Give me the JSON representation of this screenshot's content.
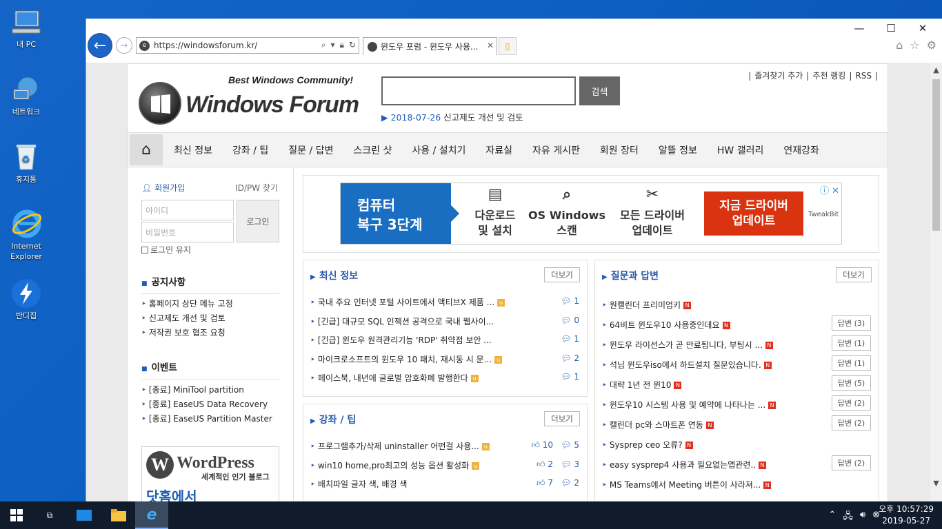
{
  "desktop": {
    "icons": [
      {
        "label": "내 PC"
      },
      {
        "label": "네트워크"
      },
      {
        "label": "휴지통"
      },
      {
        "label": "Internet Explorer"
      },
      {
        "label": "반디집"
      }
    ]
  },
  "browser": {
    "url": "https://windowsforum.kr/",
    "tab_title": "윈도우 포럼 - 윈도우 사용...",
    "window_controls": {
      "minimize": "—",
      "maximize": "☐",
      "close": "✕"
    }
  },
  "site": {
    "tagline": "Best Windows Community!",
    "logo_text": "Windows Forum",
    "search_button": "검색",
    "notice_date": "2018-07-26",
    "notice_text": " 신고제도 개선 및 검토",
    "top_links": [
      "즐겨찾기 추가",
      "추천 랭킹",
      "RSS"
    ],
    "menu": [
      "최신 정보",
      "강좌 / 팁",
      "질문 / 답변",
      "스크린 샷",
      "사용 / 설치기",
      "자료실",
      "자유 게시판",
      "회원 장터",
      "알뜰 정보",
      "HW 갤러리",
      "연재강좌"
    ],
    "login": {
      "join": "회원가입",
      "find": "ID/PW 찾기",
      "id_placeholder": "아이디",
      "pw_placeholder": "비밀번호",
      "login_button": "로그인",
      "keep": "로그인 유지"
    },
    "notices": {
      "title": "공지사항",
      "items": [
        "홈페이지 상단 메뉴 고정",
        "신고제도 개선 및 검토",
        "저작권 보호 협조 요청"
      ]
    },
    "events": {
      "title": "이벤트",
      "items": [
        "[종료] MiniTool partition",
        "[종료] EaseUS Data Recovery",
        "[종료] EaseUS Partition Master"
      ]
    },
    "wp_banner": {
      "logo": "W",
      "name": "WordPress",
      "sub": "세계적인 인기 블로그",
      "big": "닷홈에서"
    },
    "ad": {
      "left_line1": "컴퓨터",
      "left_line2": "복구 3단계",
      "item1_l1": "다운로드",
      "item1_l2": "및 설치",
      "item2_l1": "OS Windows",
      "item2_l2": "스캔",
      "item3_l1": "모든 드라이버",
      "item3_l2": "업데이트",
      "cta_l1": "지금 드라이버",
      "cta_l2": "업데이트",
      "brand": "TweakBit",
      "close": "ⓘ ✕"
    },
    "latest": {
      "title": "최신 정보",
      "more": "더보기",
      "items": [
        {
          "t": "국내 주요 인터넷 포털 사이트에서 액티브X 제품 ...",
          "c": "1",
          "u": true
        },
        {
          "t": "[긴급] 대규모 SQL 인젝션 공격으로 국내 웹사이...",
          "c": "0",
          "u": false
        },
        {
          "t": "[긴급] 윈도우 원격관리기능 'RDP' 취약점 보안 ...",
          "c": "1",
          "u": false
        },
        {
          "t": "마이크로소프트의 윈도우 10 패치, 재시동 시 문...",
          "c": "2",
          "u": true
        },
        {
          "t": "페이스북, 내년에 글로벌 암호화폐 발행한다",
          "c": "1",
          "u": true
        }
      ]
    },
    "tips": {
      "title": "강좌 / 팁",
      "more": "더보기",
      "items": [
        {
          "t": "프로그램추가/삭제 uninstaller 어떤걸 사용...",
          "l": "10",
          "c": "5"
        },
        {
          "t": "win10 home,pro최고의 성능 옵션 활성화",
          "l": "2",
          "c": "3"
        },
        {
          "t": "배치파일 글자 색, 배경 색",
          "l": "7",
          "c": "2"
        }
      ]
    },
    "qa": {
      "title": "질문과 답변",
      "more": "더보기",
      "items": [
        {
          "t": "원캘린더 프리미엄키",
          "a": ""
        },
        {
          "t": "64비트 윈도우10 사용중인데요",
          "a": "답변 (3)"
        },
        {
          "t": "윈도우 라이선스가 곧 만료됩니다, 부팅시 ...",
          "a": "답변 (1)"
        },
        {
          "t": "석님 윈도우iso에서 하드설치 질문있습니다.",
          "a": "답변 (1)"
        },
        {
          "t": "대략 1년 전 윈10",
          "a": "답변 (5)"
        },
        {
          "t": "윈도우10 시스템 사용 및 예약에 나타나는 ...",
          "a": "답변 (2)"
        },
        {
          "t": "캘린더 pc와 스마트폰 연동",
          "a": "답변 (2)"
        },
        {
          "t": "Sysprep ceo 오류?",
          "a": ""
        },
        {
          "t": "easy sysprep4 사용과 필요없는앱관련..",
          "a": "답변 (2)"
        },
        {
          "t": "MS Teams에서 Meeting 버튼이 사라져...",
          "a": ""
        }
      ]
    }
  },
  "taskbar": {
    "time": "오후 10:57:29",
    "date": "2019-05-27"
  }
}
